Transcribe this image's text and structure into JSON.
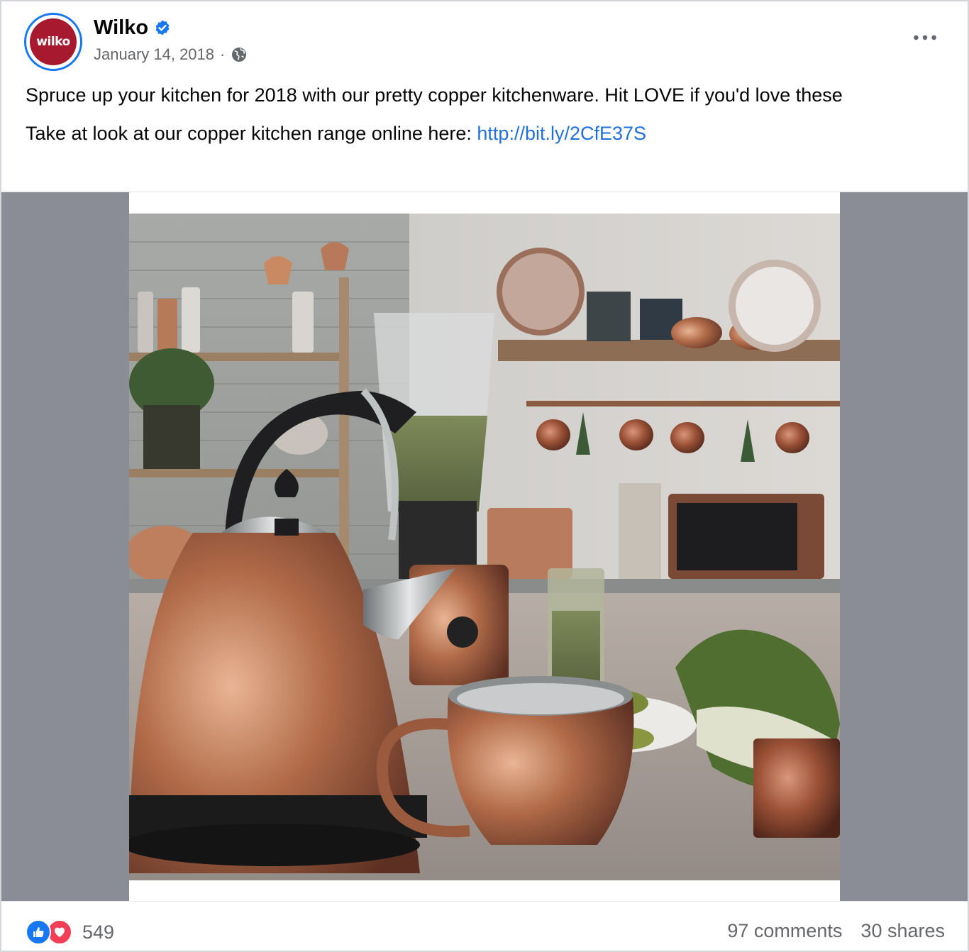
{
  "post": {
    "author": "Wilko",
    "avatar_text": "wilko",
    "date": "January 14, 2018",
    "separator": "·",
    "more_label": "•••",
    "text_line1": "Spruce up your kitchen for 2018 with our pretty copper kitchenware. Hit LOVE if you'd love these",
    "text_line2_prefix": "Take at look at our copper kitchen range online here: ",
    "link_text": "http://bit.ly/2CfE37S"
  },
  "footer": {
    "reaction_count": "549",
    "comments": "97 comments",
    "shares": "30 shares"
  },
  "colors": {
    "brand": "#a6192e",
    "accent": "#1877f2",
    "love": "#f33e58",
    "link": "#216fdb"
  },
  "icons": [
    "verified-badge-icon",
    "globe-icon",
    "more-options-icon",
    "like-reaction-icon",
    "love-reaction-icon"
  ]
}
